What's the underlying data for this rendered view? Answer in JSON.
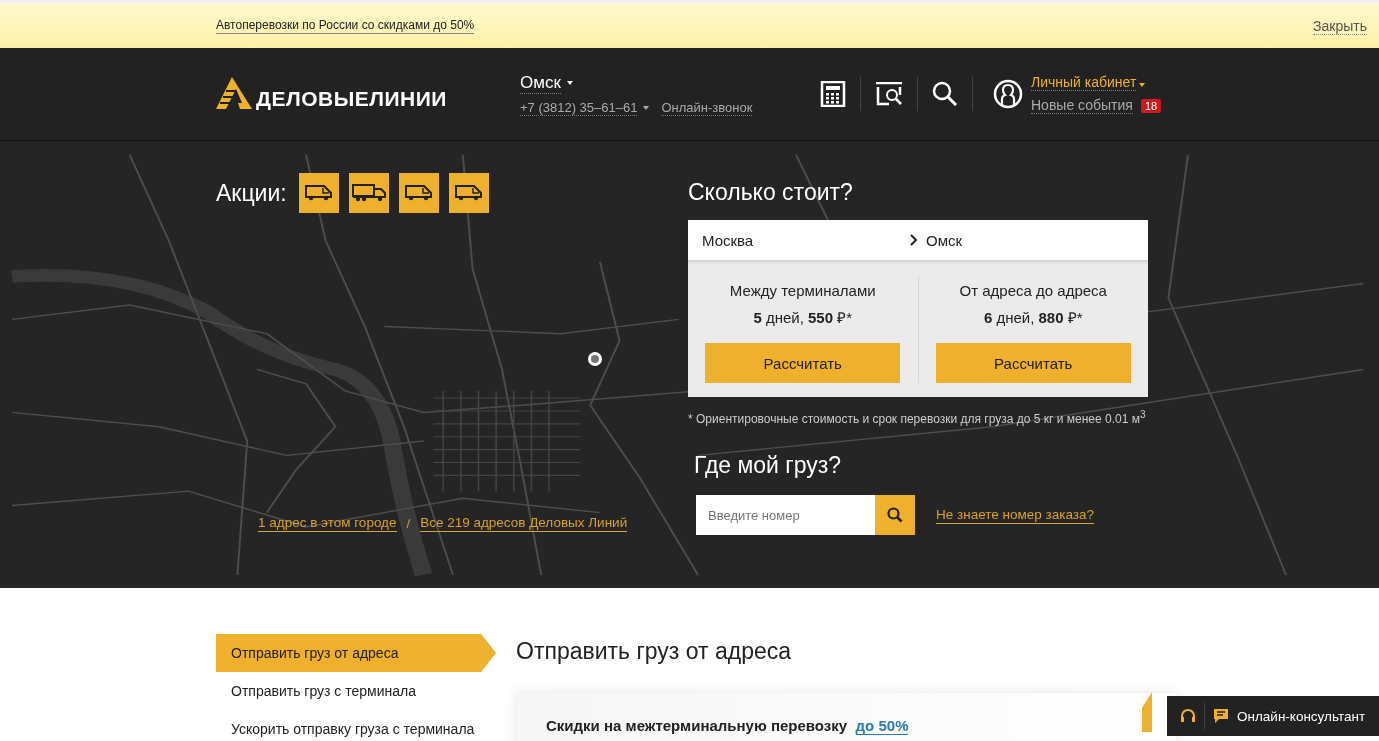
{
  "promo_bar": {
    "text": "Автоперевозки по России со скидками до 50%",
    "close": "Закрыть"
  },
  "header": {
    "logo": "ДЕЛОВЫЕЛИНИИ",
    "city": "Омск",
    "phone": "+7 (3812) 35–61–61",
    "callback": "Онлайн-звонок",
    "account": "Личный кабинет",
    "events": "Новые события",
    "events_count": "18"
  },
  "hero": {
    "promos_label": "Акции:",
    "promo_icons": [
      {
        "kind": "van"
      },
      {
        "kind": "truck"
      },
      {
        "kind": "van"
      },
      {
        "kind": "van"
      }
    ],
    "address_links": [
      {
        "text": "1 адрес в этом городе"
      },
      {
        "text": "Все 219 адресов Деловых Линий"
      }
    ],
    "separator": "/"
  },
  "calculator": {
    "title": "Сколько стоит?",
    "from": "Москва",
    "to": "Омск",
    "options": [
      {
        "title": "Между терминалами",
        "summary": "**5** дней, **550** ₽*",
        "button": "Рассчитать"
      },
      {
        "title": "От адреса до адреса",
        "summary": "**6** дней, **880** ₽*",
        "button": "Рассчитать"
      }
    ],
    "footnote": "* Ориентировочные стоимость и срок перевозки для груза до 5 кг и менее 0.01 м$^{3}$"
  },
  "tracking": {
    "title": "Где мой груз?",
    "placeholder": "Введите номер",
    "help_link": "Не знаете номер заказа?"
  },
  "sidebar": {
    "items": [
      {
        "label": "Отправить груз от адреса",
        "selected": true
      },
      {
        "label": "Отправить груз с терминала",
        "selected": false
      },
      {
        "label": "Ускорить отправку груза с терминала",
        "selected": false
      }
    ]
  },
  "section": {
    "title": "Отправить груз от адреса",
    "promo_text": "Скидки на межтерминальную перевозку",
    "promo_link": "до 50%"
  },
  "chat": {
    "label": "Онлайн-консультант"
  }
}
